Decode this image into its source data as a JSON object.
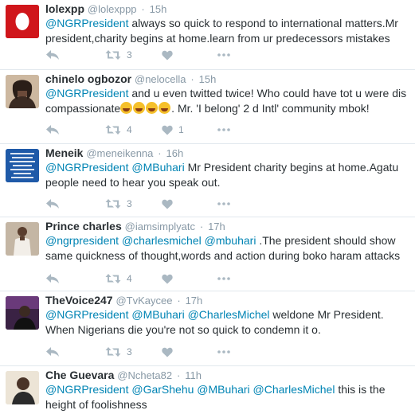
{
  "tweets": [
    {
      "name": "lolexpp",
      "handle": "@lolexppp",
      "sep": "·",
      "time": "15h",
      "mentions": [
        "@NGRPresident"
      ],
      "text": "always so quick to respond to international matters.Mr president,charity begins at home.learn from ur predecessors mistakes",
      "retweets": "3",
      "likes": "",
      "avatar_color": "#d0161b"
    },
    {
      "name": "chinelo ogbozor",
      "handle": "@nelocella",
      "sep": "·",
      "time": "15h",
      "mentions": [
        "@NGRPresident"
      ],
      "text": "and u even twitted twice! Who could have tot u were dis compassionate",
      "text_after_emoji": ". Mr. 'I belong' 2 d Intl' community mbok!",
      "emoji_name": "face-with-tears-of-joy-emoji",
      "emoji_count": 4,
      "retweets": "4",
      "likes": "1",
      "avatar_color": "#6b4a3a"
    },
    {
      "name": "Meneik",
      "handle": "@meneikenna",
      "sep": "·",
      "time": "16h",
      "mentions": [
        "@NGRPresident",
        "@MBuhari"
      ],
      "text": "Mr President charity begins at home.Agatu people need to hear you speak out.",
      "retweets": "3",
      "likes": "",
      "avatar_color": "#1f5aa8"
    },
    {
      "name": "Prince charles",
      "handle": "@iamsimplyatc",
      "sep": "·",
      "time": "17h",
      "mentions": [
        "@ngrpresident",
        "@charlesmichel",
        "@mbuhari"
      ],
      "text": ".The president should show same quickness of thought,words and action during boko haram attacks",
      "retweets": "4",
      "likes": "",
      "avatar_color": "#7d6a5a"
    },
    {
      "name": "TheVoice247",
      "handle": "@TvKaycee",
      "sep": "·",
      "time": "17h",
      "mentions": [
        "@NGRPresident",
        "@MBuhari",
        "@CharlesMichel"
      ],
      "text": "weldone Mr President. When Nigerians die you're not so quick to condemn it o.",
      "retweets": "3",
      "likes": "",
      "avatar_color": "#4a2a52"
    },
    {
      "name": "Che Guevara",
      "handle": "@Ncheta82",
      "sep": "·",
      "time": "11h",
      "mentions": [
        "@NGRPresident",
        "@GarShehu",
        "@MBuhari",
        "@CharlesMichel"
      ],
      "text": "this is the height of foolishness",
      "retweets": "",
      "likes": "",
      "avatar_color": "#d9c7a8"
    }
  ],
  "colors": {
    "name": "#292f33",
    "meta": "#8899a6",
    "mention": "#0084b4",
    "icon": "#aab8c2",
    "divider": "#e1e8ed"
  },
  "icons": [
    "reply-icon",
    "retweet-icon",
    "like-icon",
    "more-icon"
  ]
}
